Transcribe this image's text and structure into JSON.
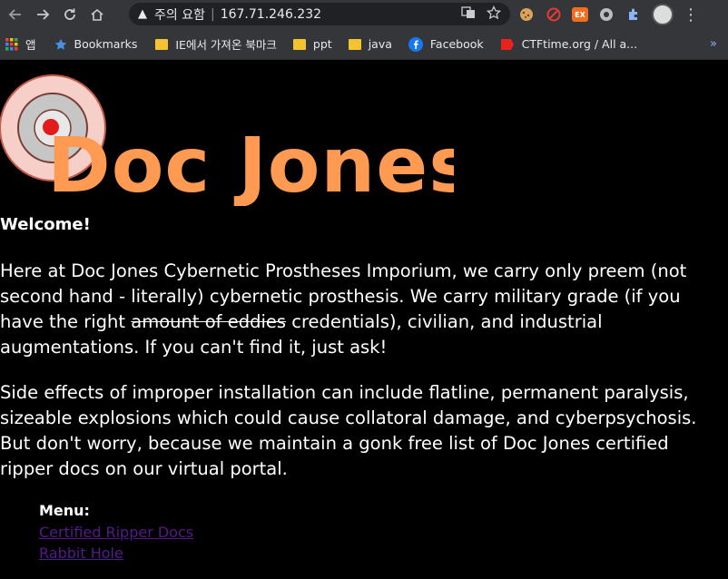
{
  "browser": {
    "security_label": "주의 요함",
    "url_host": "167.71.246.232"
  },
  "bookmarks": [
    {
      "label": "앱",
      "icon": "apps-grid-icon"
    },
    {
      "label": "Bookmarks",
      "icon": "star-icon"
    },
    {
      "label": "IE에서 가져온 북마크",
      "icon": "folder-icon"
    },
    {
      "label": "ppt",
      "icon": "folder-icon"
    },
    {
      "label": "java",
      "icon": "folder-icon"
    },
    {
      "label": "Facebook",
      "icon": "facebook-icon"
    },
    {
      "label": "CTFtime.org / All a...",
      "icon": "ctftime-icon"
    }
  ],
  "page": {
    "logo_text": "Doc Jones",
    "welcome": "Welcome!",
    "paragraph1_before": "Here at Doc Jones Cybernetic Prostheses Imporium, we carry only preem (not second hand - literally) cybernetic prosthesis. We carry military grade (if you have the right ",
    "paragraph1_struck": "amount of eddies",
    "paragraph1_after": " credentials), civilian, and industrial augmentations. If you can't find it, just ask!",
    "paragraph2": "Side effects of improper installation can include flatline, permanent paralysis, sizeable explosions which could cause collatoral damage, and cyberpsychosis. But don't worry, because we maintain a gonk free list of Doc Jones certified ripper docs on our virtual portal.",
    "menu_title": "Menu:",
    "menu_links": [
      "Certified Ripper Docs",
      "Rabbit Hole"
    ]
  },
  "colors": {
    "logo_orange": "#ff9a52",
    "link_visited": "#551a8b",
    "chrome_bg": "#35363a"
  }
}
